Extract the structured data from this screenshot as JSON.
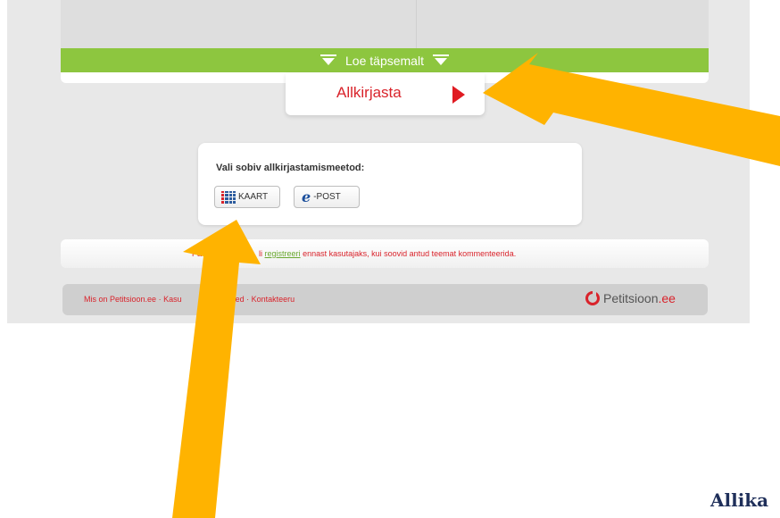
{
  "header": {
    "read_more_label": "Loe täpsemalt",
    "sign_label": "Allkirjasta"
  },
  "sign_methods": {
    "title": "Vali sobiv allkirjastamismeetod:",
    "kaart_label": "KAART",
    "epost_symbol": "e",
    "epost_label": "-POST"
  },
  "info_strip": {
    "text_before": "Pa",
    "text_hidden": "li",
    "link": "registreeri",
    "text_after": "ennast kasutajaks, kui soovid antud teemat kommenteerida."
  },
  "footer": {
    "link1": "Mis on Petitsioon.ee",
    "sep": "·",
    "link2_visible": "Kasu",
    "link2_end": "ed",
    "link3": "Kontakteeru",
    "logo_text": "Petitsioon",
    "logo_suffix": ".ee"
  },
  "corner_caption": "Allika",
  "colors": {
    "accent_green": "#8dc63f",
    "brand_red": "#d9232b",
    "annotation_arrow": "#ffb300"
  }
}
